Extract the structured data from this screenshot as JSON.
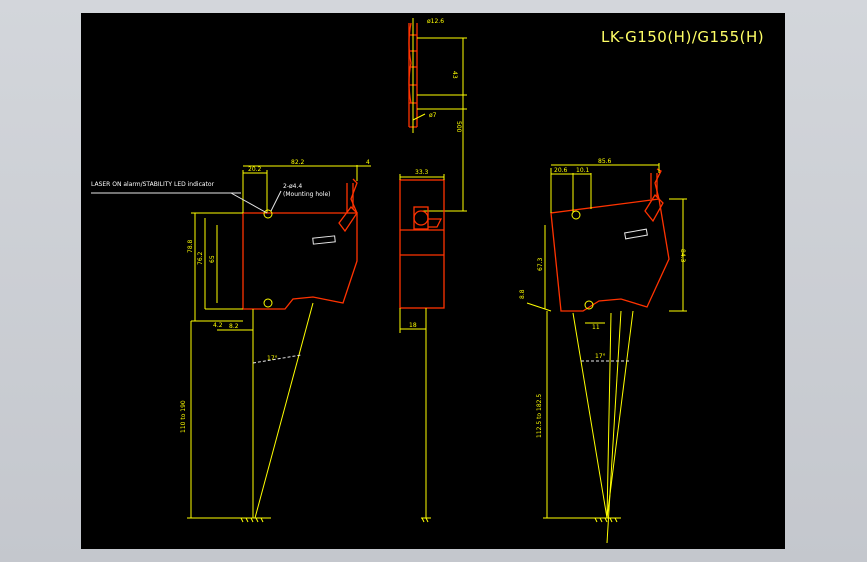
{
  "drawing": {
    "title": "LK-G150(H)/G155(H)",
    "labels": {
      "led": "LASER ON alarm/STABILITY LED indicator",
      "hole": "2-ø4.4",
      "hole_note": "(Mounting hole)",
      "cable_dia": "ø12.6",
      "cable_len": "43",
      "cable_500": "500",
      "cable_dia2": "ø7"
    },
    "left_view": {
      "dims": [
        "20.2",
        "82.2",
        "4",
        "78.8",
        "76.2",
        "65",
        "4.2",
        "8.2",
        "17°",
        "110 to 190"
      ]
    },
    "middle_view": {
      "dims": [
        "33.3",
        "18"
      ]
    },
    "right_view": {
      "dims": [
        "20.6",
        "10.1",
        "85.6",
        "67.3",
        "84.3",
        "8.8",
        "11",
        "17°",
        "112.5 to 182.5"
      ]
    }
  }
}
